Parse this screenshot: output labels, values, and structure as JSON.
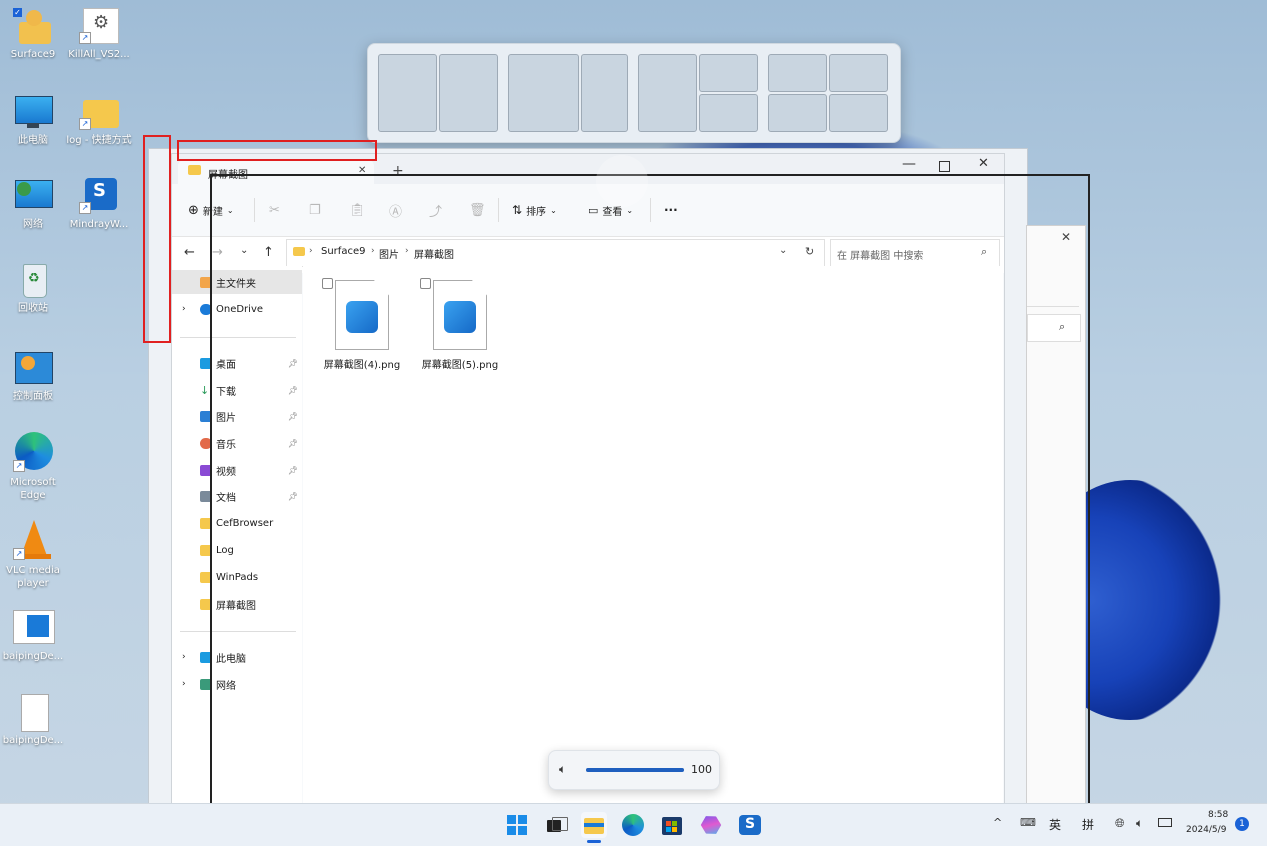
{
  "desktop": {
    "icons": [
      {
        "label": "Surface9"
      },
      {
        "label": "KillAll_VS2..."
      },
      {
        "label": "此电脑"
      },
      {
        "label": "log - 快捷方式"
      },
      {
        "label": "网络"
      },
      {
        "label": "MindrayW..."
      },
      {
        "label": "回收站"
      },
      {
        "label": "控制面板"
      },
      {
        "label": "Microsoft Edge"
      },
      {
        "label": "VLC media player"
      },
      {
        "label": "baipingDe..."
      },
      {
        "label": "baipingDe..."
      }
    ]
  },
  "explorer": {
    "tab_title": "屏幕截图",
    "toolbar": {
      "new_label": "新建",
      "sort_label": "排序",
      "view_label": "查看",
      "more_label": "···"
    },
    "breadcrumb": [
      "Surface9",
      "图片",
      "屏幕截图"
    ],
    "search_placeholder": "在 屏幕截图 中搜索",
    "sidebar": {
      "home": "主文件夹",
      "onedrive": "OneDrive",
      "quick": [
        "桌面",
        "下载",
        "图片",
        "音乐",
        "视频",
        "文档",
        "CefBrowser",
        "Log",
        "WinPads",
        "屏幕截图"
      ],
      "thispc": "此电脑",
      "network": "网络"
    },
    "files": [
      {
        "name": "屏幕截图(4).png"
      },
      {
        "name": "屏幕截图(5).png"
      }
    ]
  },
  "volume": {
    "value": "100",
    "level": 1.0
  },
  "taskbar": {
    "ime_lang": "英",
    "ime_mode": "拼",
    "time": "8:58",
    "date": "2024/5/9",
    "notification_count": "1"
  }
}
